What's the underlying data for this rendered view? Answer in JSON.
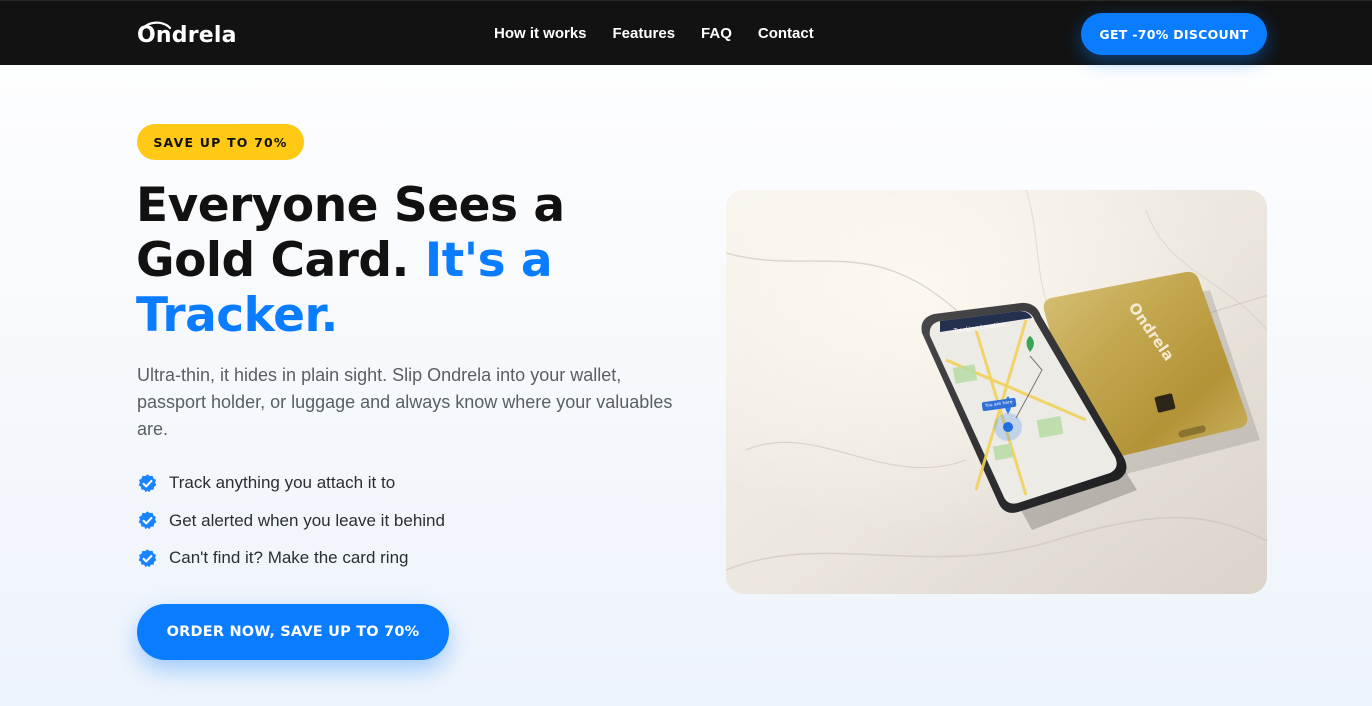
{
  "header": {
    "logo_text": "Ondrela",
    "nav": [
      {
        "label": "How it works"
      },
      {
        "label": "Features"
      },
      {
        "label": "FAQ"
      },
      {
        "label": "Contact"
      }
    ],
    "cta_label": "GET -70% DISCOUNT"
  },
  "hero": {
    "badge": "SAVE UP TO 70%",
    "headline_part1": "Everyone Sees a Gold Card.",
    "headline_accent": "It's a Tracker.",
    "lead": "Ultra-thin, it hides in plain sight. Slip Ondrela into your wallet, passport holder, or luggage and always know where your valuables are.",
    "features": [
      {
        "label": "Track anything you attach it to",
        "icon": "verified-check-icon"
      },
      {
        "label": "Get alerted when you leave it behind",
        "icon": "verified-check-icon"
      },
      {
        "label": "Can't find it? Make the card ring",
        "icon": "verified-check-icon"
      }
    ],
    "cta_label": "ORDER NOW, SAVE UP TO 70%",
    "image": {
      "phone_status": "Tracking Location...",
      "phone_pin_label": "You are here",
      "card_brand": "Ondrela"
    }
  },
  "colors": {
    "accent": "#0a7cff",
    "badge": "#ffc916",
    "header_bg": "#121212"
  }
}
